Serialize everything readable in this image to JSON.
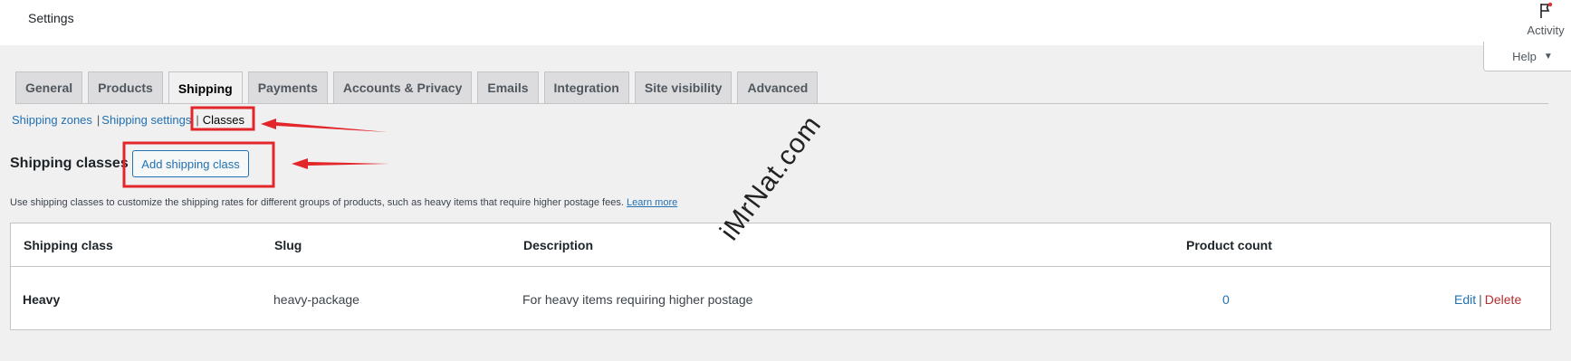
{
  "header": {
    "title": "Settings",
    "activity_label": "Activity",
    "help_label": "Help"
  },
  "tabs": [
    {
      "label": "General",
      "active": false
    },
    {
      "label": "Products",
      "active": false
    },
    {
      "label": "Shipping",
      "active": true
    },
    {
      "label": "Payments",
      "active": false
    },
    {
      "label": "Accounts & Privacy",
      "active": false
    },
    {
      "label": "Emails",
      "active": false
    },
    {
      "label": "Integration",
      "active": false
    },
    {
      "label": "Site visibility",
      "active": false
    },
    {
      "label": "Advanced",
      "active": false
    }
  ],
  "subnav": {
    "zones": "Shipping zones",
    "settings": "Shipping settings",
    "classes": "Classes",
    "separator": "|"
  },
  "page": {
    "heading": "Shipping classes",
    "add_button": "Add shipping class",
    "description": "Use shipping classes to customize the shipping rates for different groups of products, such as heavy items that require higher postage fees.",
    "learn_more": "Learn more"
  },
  "table": {
    "columns": [
      "Shipping class",
      "Slug",
      "Description",
      "Product count"
    ],
    "rows": [
      {
        "name": "Heavy",
        "slug": "heavy-package",
        "description": "For heavy items requiring higher postage",
        "count": "0",
        "edit": "Edit",
        "delete": "Delete"
      }
    ]
  },
  "watermark": "iMrNat.com",
  "colors": {
    "accent": "#2271b1",
    "annotation": "#e3262a",
    "delete": "#b32d2e"
  }
}
